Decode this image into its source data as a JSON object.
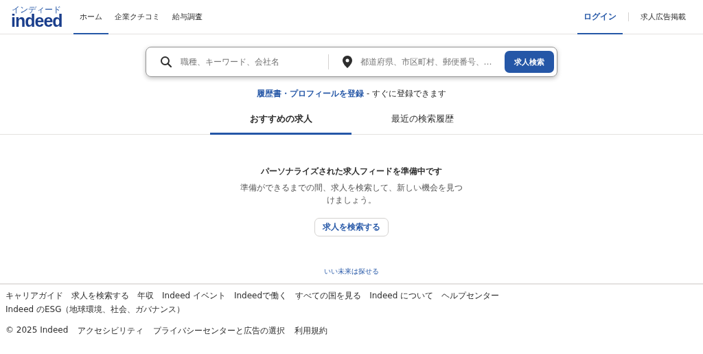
{
  "header": {
    "logo": {
      "text": "indeed",
      "kana": "インディード"
    },
    "nav": [
      {
        "label": "ホーム",
        "selected": true
      },
      {
        "label": "企業クチコミ",
        "selected": false
      },
      {
        "label": "給与調査",
        "selected": false
      }
    ],
    "right": [
      {
        "label": "ログイン",
        "selected": true
      },
      {
        "label": "求人広告掲載",
        "selected": false
      }
    ]
  },
  "search": {
    "what_placeholder": "職種、キーワード、会社名",
    "where_placeholder": "都道府県、市区町村、郵便番号、…",
    "button": "求人検索"
  },
  "register": {
    "link": "履歴書・プロフィールを登録",
    "text": "- すぐに登録できます"
  },
  "tabs": [
    {
      "label": "おすすめの求人",
      "selected": true
    },
    {
      "label": "最近の検索履歴",
      "selected": false
    }
  ],
  "feed": {
    "title": "パーソナライズされた求人フィードを準備中です",
    "message": "準備ができるまでの間、求人を検索して、新しい機会を見つけましょう。",
    "button": "求人を検索する"
  },
  "tagline": "いい未来は探せる",
  "footer": {
    "links": [
      "キャリアガイド",
      "求人を検索する",
      "年収",
      "Indeed イベント",
      "Indeedで働く",
      "すべての国を見る",
      "Indeed について",
      "ヘルプセンター",
      "Indeed のESG（地球環境、社会、ガバナンス）"
    ],
    "copyright": "© 2025 Indeed",
    "legal": [
      "アクセシビリティ",
      "プライバシーセンターと広告の選択",
      "利用規約"
    ]
  }
}
